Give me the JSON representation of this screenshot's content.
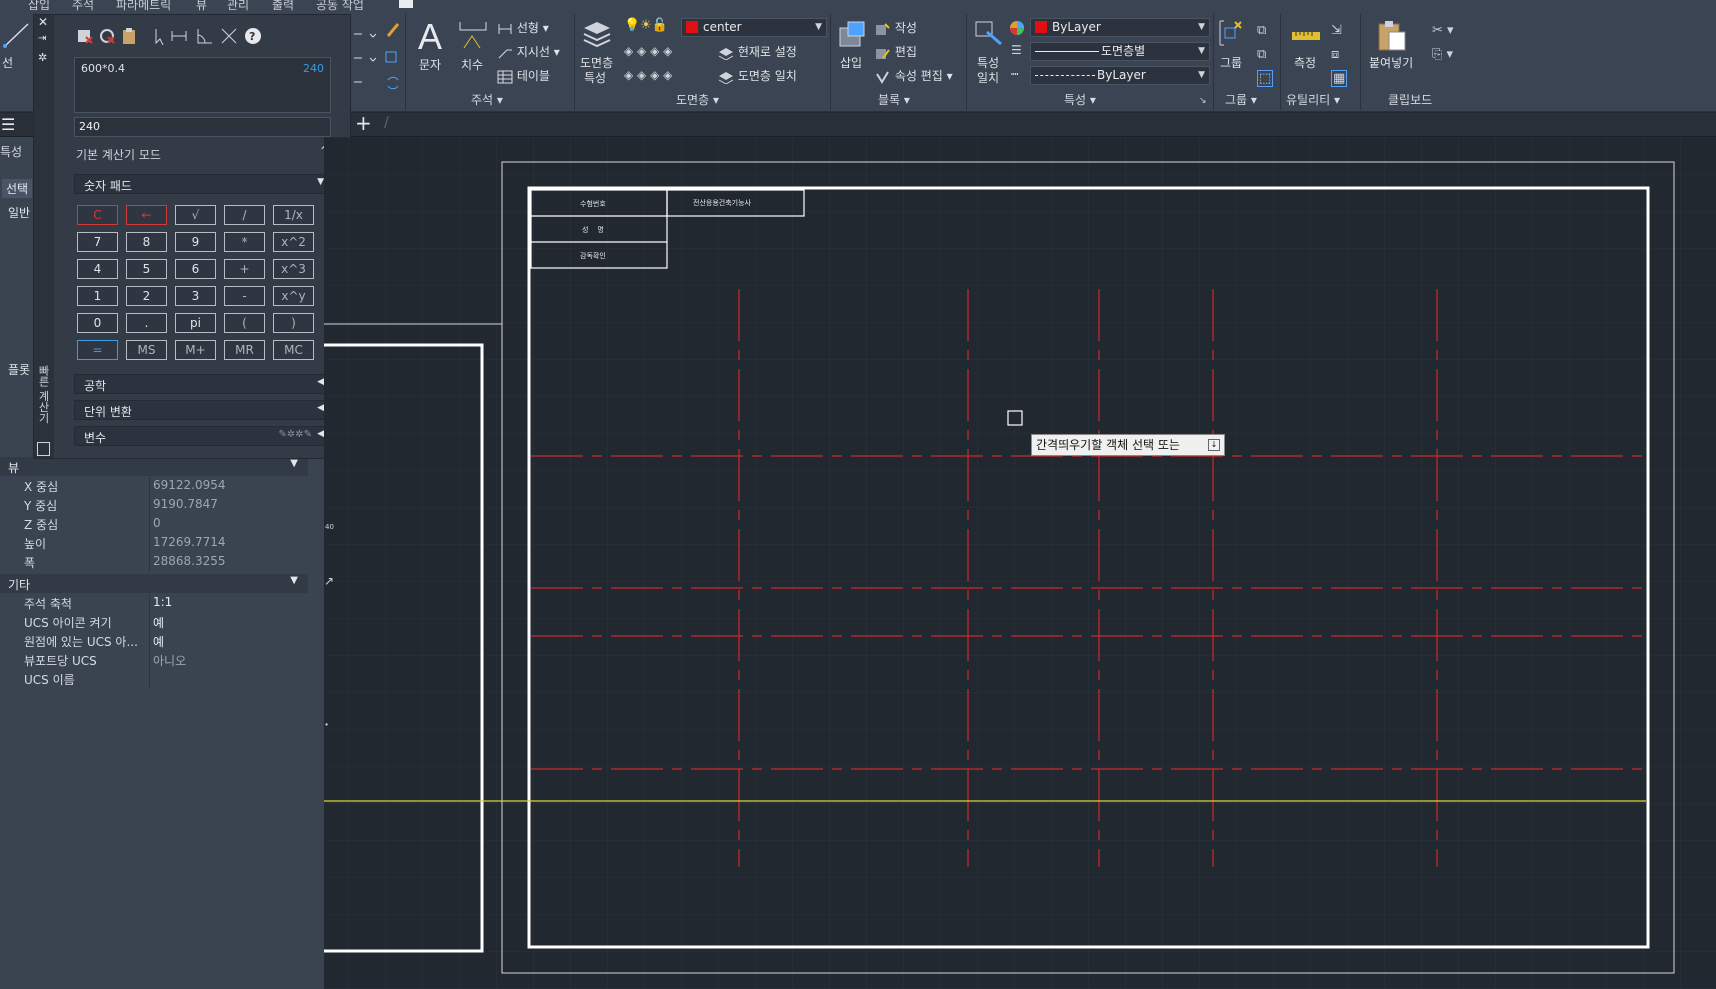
{
  "menu": [
    "삽입",
    "주석",
    "파라메트릭",
    "뷰",
    "관리",
    "출력",
    "공동 작업"
  ],
  "ribbon": {
    "panels": {
      "annotation": "주석",
      "layers": "도면층",
      "block": "블록",
      "properties": "특성",
      "groups": "그룹",
      "utilities": "유틸리티",
      "clipboard": "클립보드"
    },
    "annotation": {
      "text": "문자",
      "dimension": "치수",
      "linear": "선형",
      "leader": "지시선",
      "table": "테이블"
    },
    "layers": {
      "properties_l1": "도면층",
      "properties_l2": "특성",
      "current_layer": "center",
      "make_current": "현재로 설정",
      "match_layer": "도면층 일치"
    },
    "block": {
      "insert": "삽입",
      "create": "작성",
      "edit": "편집",
      "edit_attributes": "속성 편집"
    },
    "properties": {
      "match_l1": "특성",
      "match_l2": "일치",
      "color": "ByLayer",
      "lineweight": "도면층별",
      "linetype": "ByLayer"
    },
    "groups": {
      "group": "그룹"
    },
    "utilities": {
      "measure": "측정"
    },
    "clipboard": {
      "paste": "붙여넣기"
    },
    "left_partial": {
      "line": "선"
    }
  },
  "calculator": {
    "history_expression": "600*0.4",
    "history_result": "240",
    "input_value": "240",
    "mode_label": "기본 계산기 모드",
    "numpad_title": "숫자 패드",
    "buttons": [
      [
        "C",
        "←",
        "√",
        "/",
        "1/x"
      ],
      [
        "7",
        "8",
        "9",
        "*",
        "x^2"
      ],
      [
        "4",
        "5",
        "6",
        "+",
        "x^3"
      ],
      [
        "1",
        "2",
        "3",
        "-",
        "x^y"
      ],
      [
        "0",
        ".",
        "pi",
        "(",
        ")"
      ],
      [
        "=",
        "MS",
        "M+",
        "MR",
        "MC"
      ]
    ],
    "sections": [
      "공학",
      "단위 변환",
      "변수"
    ],
    "side_title": "빠른 계산기"
  },
  "properties_palette": {
    "title": "특성",
    "selection": "선택",
    "general_header": "일반",
    "plot_header": "플롯",
    "view_header": "뷰",
    "view_rows": [
      {
        "key": "X 중심",
        "value": "69122.0954"
      },
      {
        "key": "Y 중심",
        "value": "9190.7847"
      },
      {
        "key": "Z 중심",
        "value": "0"
      },
      {
        "key": "높이",
        "value": "17269.7714"
      },
      {
        "key": "폭",
        "value": "28868.3255"
      }
    ],
    "misc_header": "기타",
    "misc_rows": [
      {
        "key": "주석 축척",
        "value": "1:1"
      },
      {
        "key": "UCS 아이콘 켜기",
        "value": "예"
      },
      {
        "key": "원점에 있는 UCS 아...",
        "value": "예"
      },
      {
        "key": "뷰포트당 UCS",
        "value": "아니오"
      },
      {
        "key": "UCS 이름",
        "value": ""
      }
    ]
  },
  "drawing": {
    "title_block": {
      "exam_label": "수험번호",
      "exam_value": "전산응용건축기능사",
      "name_label": "성    명",
      "supervisor_label": "감독확인"
    },
    "tooltip": "간격띄우기할 객체 선택 또는",
    "colors": {
      "axis_line": "#cc2a2a",
      "frame": "#ffffff",
      "guide": "#d6d630",
      "background": "#212830"
    }
  }
}
